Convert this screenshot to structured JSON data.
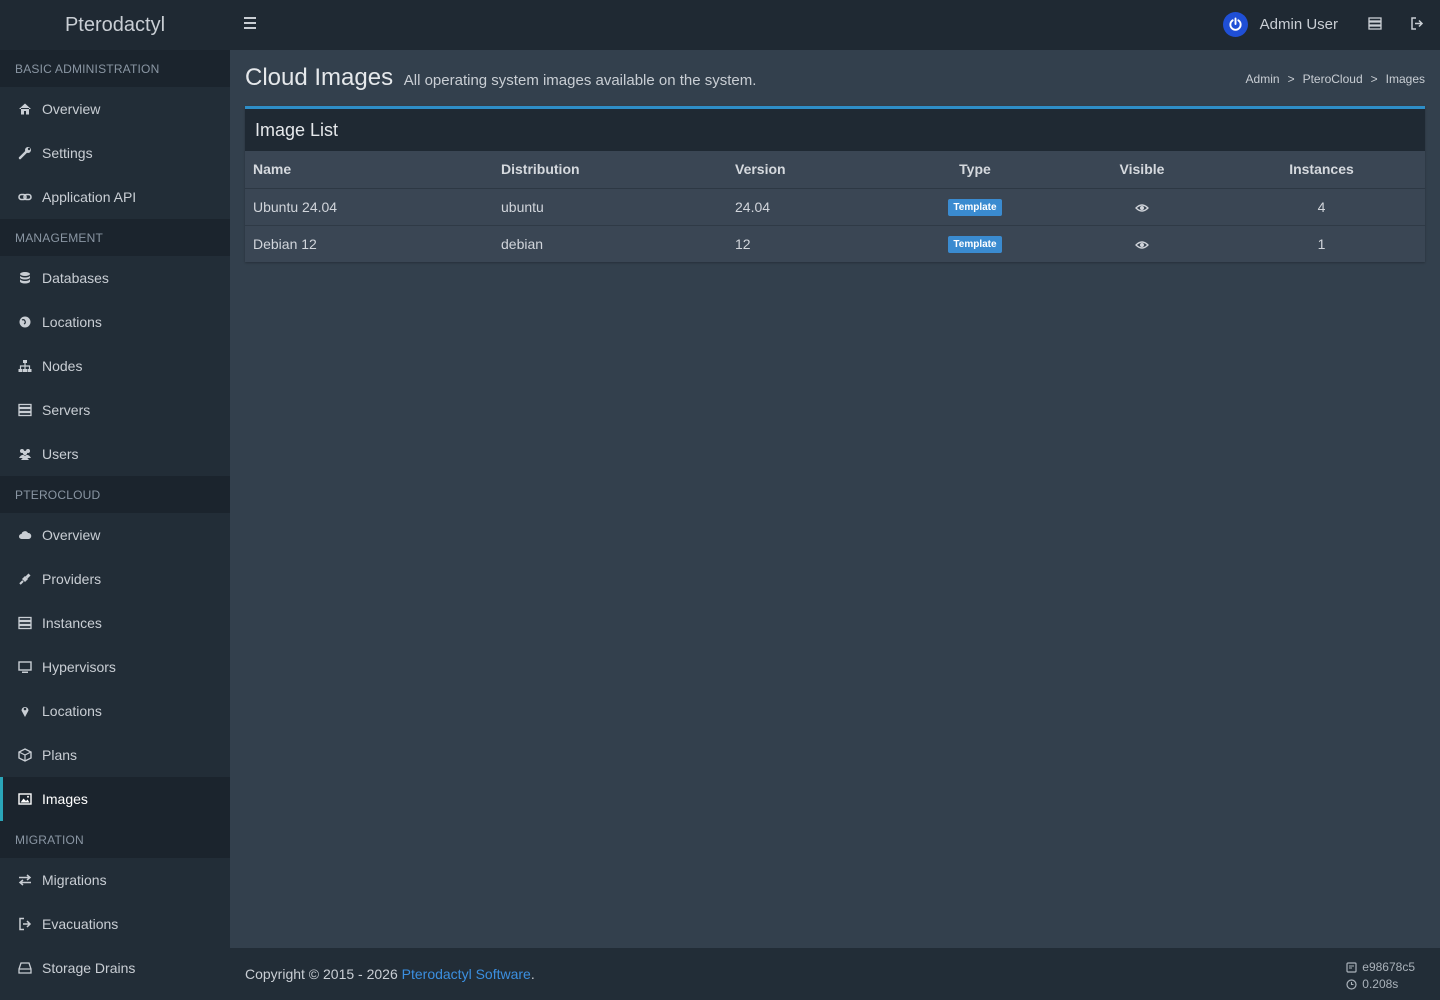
{
  "app": {
    "title": "Pterodactyl"
  },
  "header": {
    "user_name": "Admin User"
  },
  "sidebar": {
    "sections": [
      {
        "header": "BASIC ADMINISTRATION",
        "items": [
          {
            "label": "Overview",
            "icon": "home-icon"
          },
          {
            "label": "Settings",
            "icon": "wrench-icon"
          },
          {
            "label": "Application API",
            "icon": "link-icon"
          }
        ]
      },
      {
        "header": "MANAGEMENT",
        "items": [
          {
            "label": "Databases",
            "icon": "database-icon"
          },
          {
            "label": "Locations",
            "icon": "globe-icon"
          },
          {
            "label": "Nodes",
            "icon": "sitemap-icon"
          },
          {
            "label": "Servers",
            "icon": "server-icon"
          },
          {
            "label": "Users",
            "icon": "users-icon"
          }
        ]
      },
      {
        "header": "PTEROCLOUD",
        "items": [
          {
            "label": "Overview",
            "icon": "cloud-icon"
          },
          {
            "label": "Providers",
            "icon": "plug-icon"
          },
          {
            "label": "Instances",
            "icon": "server-icon"
          },
          {
            "label": "Hypervisors",
            "icon": "desktop-icon"
          },
          {
            "label": "Locations",
            "icon": "map-marker-icon"
          },
          {
            "label": "Plans",
            "icon": "cube-icon"
          },
          {
            "label": "Images",
            "icon": "image-icon",
            "active": true
          }
        ]
      },
      {
        "header": "MIGRATION",
        "items": [
          {
            "label": "Migrations",
            "icon": "exchange-icon"
          },
          {
            "label": "Evacuations",
            "icon": "sign-out-icon"
          },
          {
            "label": "Storage Drains",
            "icon": "hdd-icon"
          }
        ]
      }
    ]
  },
  "page": {
    "title": "Cloud Images",
    "subtitle": "All operating system images available on the system.",
    "breadcrumb": [
      "Admin",
      "PteroCloud",
      "Images"
    ]
  },
  "box": {
    "title": "Image List",
    "columns": [
      "Name",
      "Distribution",
      "Version",
      "Type",
      "Visible",
      "Instances"
    ],
    "rows": [
      {
        "name": "Ubuntu 24.04",
        "distribution": "ubuntu",
        "version": "24.04",
        "type": "Template",
        "visible": "eye-icon",
        "instances": "4"
      },
      {
        "name": "Debian 12",
        "distribution": "debian",
        "version": "12",
        "type": "Template",
        "visible": "eye-icon",
        "instances": "1"
      }
    ]
  },
  "footer": {
    "copyright": "Copyright © 2015 - 2026 ",
    "link_text": "Pterodactyl Software",
    "period": ".",
    "commit": "e98678c5",
    "render_time": "0.208s"
  },
  "colors": {
    "accent": "#2e8ec7",
    "active_bar": "#2aa5b8",
    "badge": "#3a8bd0",
    "link": "#3b8fe0"
  }
}
